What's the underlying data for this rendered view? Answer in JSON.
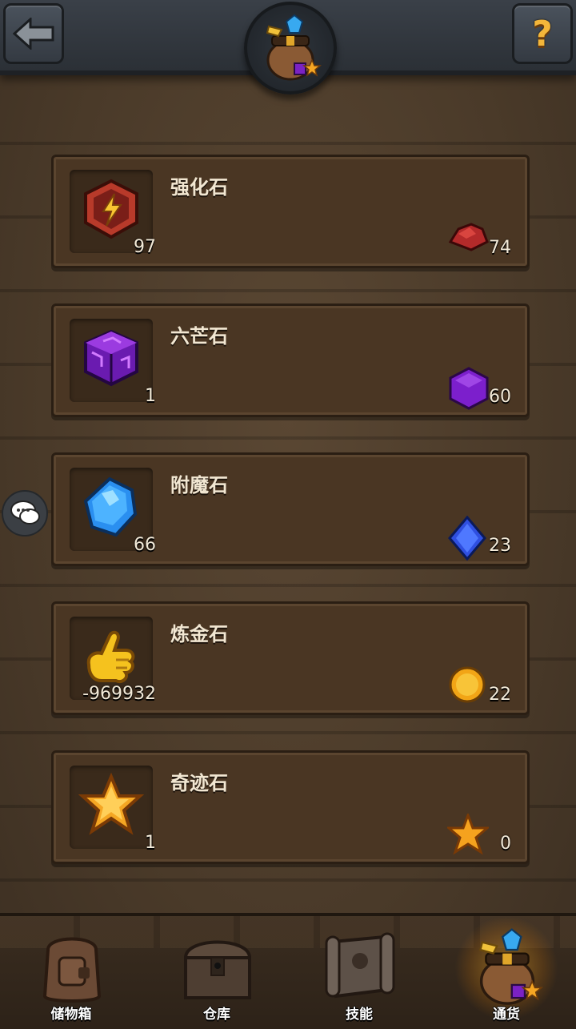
{
  "header": {
    "back_icon": "arrow-left-icon",
    "help_label": "?",
    "emblem_icon": "treasure-bag-icon"
  },
  "items": [
    {
      "name": "强化石",
      "owned": "97",
      "count": "74",
      "icon": "enhance-stone-icon",
      "mini_icon": "red-ore-icon"
    },
    {
      "name": "六芒石",
      "owned": "1",
      "count": "60",
      "icon": "purple-cube-icon",
      "mini_icon": "purple-hexagon-icon"
    },
    {
      "name": "附魔石",
      "owned": "66",
      "count": "23",
      "icon": "blue-gem-icon",
      "mini_icon": "blue-diamond-icon"
    },
    {
      "name": "炼金石",
      "owned": "-969932",
      "count": "22",
      "icon": "golden-hand-icon",
      "mini_icon": "gold-coin-icon"
    },
    {
      "name": "奇迹石",
      "owned": "1",
      "count": "0",
      "icon": "orange-star-icon",
      "mini_icon": "small-star-icon"
    }
  ],
  "chat": {
    "icon": "chat-bubble-icon"
  },
  "nav": [
    {
      "label": "储物箱",
      "icon": "backpack-icon"
    },
    {
      "label": "仓库",
      "icon": "chest-icon"
    },
    {
      "label": "技能",
      "icon": "scroll-icon"
    },
    {
      "label": "通货",
      "icon": "treasure-bag-icon",
      "active": true
    }
  ],
  "colors": {
    "wood": "#4a3623",
    "topbar": "#2b3036",
    "accent_gold": "#f4b63a"
  }
}
